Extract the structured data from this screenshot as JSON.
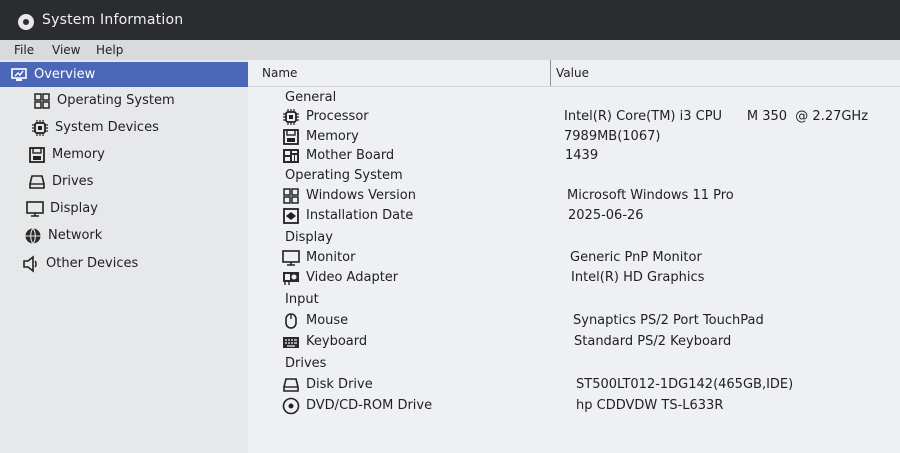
{
  "window": {
    "title": "System Information"
  },
  "menu": {
    "file": "File",
    "view": "View",
    "help": "Help"
  },
  "sidebar": {
    "items": [
      {
        "label": "Overview",
        "icon": "monitor-chart-icon"
      },
      {
        "label": "Operating System",
        "icon": "windows-logo-icon"
      },
      {
        "label": "System Devices",
        "icon": "chip-icon"
      },
      {
        "label": "Memory",
        "icon": "memory-icon"
      },
      {
        "label": "Drives",
        "icon": "drive-icon"
      },
      {
        "label": "Display",
        "icon": "display-icon"
      },
      {
        "label": "Network",
        "icon": "globe-icon"
      },
      {
        "label": "Other Devices",
        "icon": "speaker-icon"
      }
    ]
  },
  "table": {
    "headers": {
      "name": "Name",
      "value": "Value"
    },
    "groups": [
      {
        "name": "General",
        "rows": [
          {
            "label": "Processor",
            "icon": "chip-icon",
            "value": "Intel(R) Core(TM) i3 CPU      M 350  @ 2.27GHz"
          },
          {
            "label": "Memory",
            "icon": "memory-icon",
            "value": "7989MB(1067)"
          },
          {
            "label": "Mother Board",
            "icon": "motherboard-icon",
            "value": "1439"
          }
        ]
      },
      {
        "name": "Operating System",
        "rows": [
          {
            "label": "Windows Version",
            "icon": "windows-logo-icon",
            "value": "Microsoft Windows 11 Pro"
          },
          {
            "label": "Installation Date",
            "icon": "installer-icon",
            "value": "2025-06-26"
          }
        ]
      },
      {
        "name": "Display",
        "rows": [
          {
            "label": "Monitor",
            "icon": "monitor-icon",
            "value": "Generic PnP Monitor"
          },
          {
            "label": "Video Adapter",
            "icon": "video-adapter-icon",
            "value": "Intel(R) HD Graphics"
          }
        ]
      },
      {
        "name": "Input",
        "rows": [
          {
            "label": "Mouse",
            "icon": "mouse-icon",
            "value": "Synaptics PS/2 Port TouchPad"
          },
          {
            "label": "Keyboard",
            "icon": "keyboard-icon",
            "value": "Standard PS/2 Keyboard"
          }
        ]
      },
      {
        "name": "Drives",
        "rows": [
          {
            "label": "Disk Drive",
            "icon": "disk-drive-icon",
            "value": "ST500LT012-1DG142(465GB,IDE)"
          },
          {
            "label": "DVD/CD-ROM Drive",
            "icon": "cd-rom-icon",
            "value": "hp CDDVDW TS-L633R"
          }
        ]
      }
    ]
  },
  "colors": {
    "selection": "#4d67b8",
    "titlebar": "#2a2c30"
  }
}
